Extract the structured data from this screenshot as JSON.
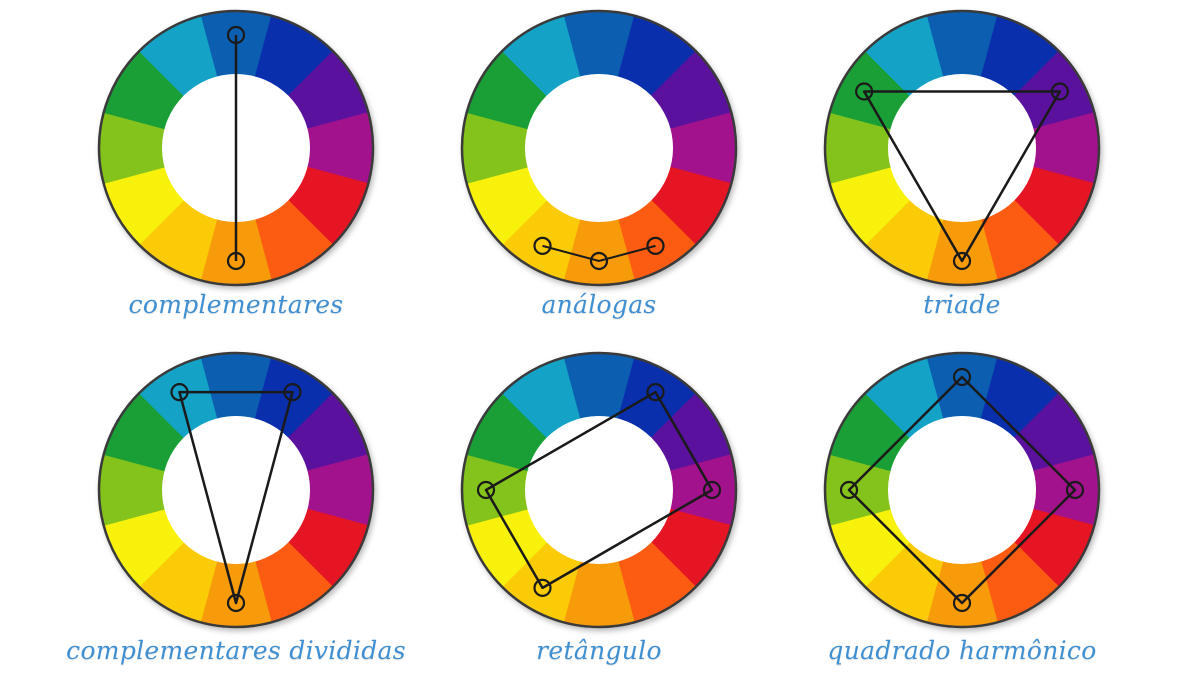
{
  "wheel": {
    "segment_colors": [
      "#0c5fb0",
      "#0a2fad",
      "#5a129e",
      "#a3128d",
      "#e51523",
      "#fb5c12",
      "#f79b0a",
      "#fbcb07",
      "#f7f10c",
      "#84c21c",
      "#199f36",
      "#14a3c7"
    ],
    "outline_color": "#3a3a3a",
    "marker_color": "#1a1a1a"
  },
  "harmonies": [
    {
      "label": "complementares",
      "markers": [
        0,
        6
      ],
      "closed": false,
      "curved": false
    },
    {
      "label": "análogas",
      "markers": [
        7,
        6,
        5
      ],
      "closed": false,
      "curved": true
    },
    {
      "label": "triade",
      "markers": [
        10,
        2,
        6
      ],
      "closed": true,
      "curved": false
    },
    {
      "label": "complementares divididas",
      "markers": [
        11,
        1,
        6
      ],
      "closed": true,
      "curved": false
    },
    {
      "label": "retângulo",
      "markers": [
        1,
        3,
        7,
        9
      ],
      "closed": true,
      "curved": false
    },
    {
      "label": "quadrado harmônico",
      "markers": [
        0,
        3,
        6,
        9
      ],
      "closed": true,
      "curved": false
    }
  ]
}
